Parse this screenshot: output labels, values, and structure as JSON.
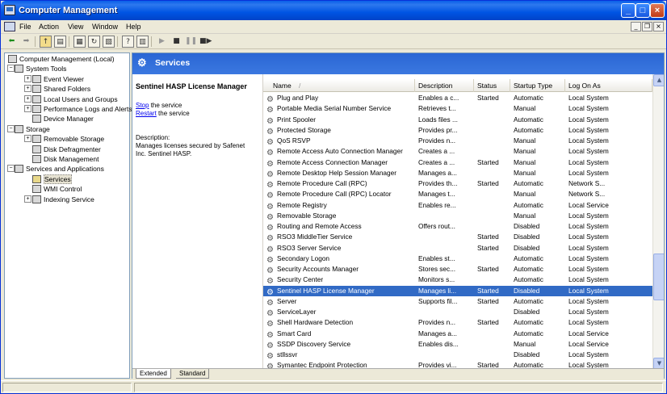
{
  "window": {
    "title": "Computer Management"
  },
  "menu": [
    "File",
    "Action",
    "View",
    "Window",
    "Help"
  ],
  "tree": [
    {
      "label": "Computer Management (Local)",
      "level": 0,
      "exp": "",
      "icon": "computer-icon"
    },
    {
      "label": "System Tools",
      "level": 1,
      "exp": "−",
      "icon": "tools-icon"
    },
    {
      "label": "Event Viewer",
      "level": 2,
      "exp": "+",
      "icon": "event-viewer-icon"
    },
    {
      "label": "Shared Folders",
      "level": 2,
      "exp": "+",
      "icon": "folder-icon"
    },
    {
      "label": "Local Users and Groups",
      "level": 2,
      "exp": "+",
      "icon": "users-icon"
    },
    {
      "label": "Performance Logs and Alerts",
      "level": 2,
      "exp": "+",
      "icon": "performance-icon"
    },
    {
      "label": "Device Manager",
      "level": 2,
      "exp": "",
      "icon": "device-manager-icon"
    },
    {
      "label": "Storage",
      "level": 1,
      "exp": "−",
      "icon": "storage-icon"
    },
    {
      "label": "Removable Storage",
      "level": 2,
      "exp": "+",
      "icon": "removable-storage-icon"
    },
    {
      "label": "Disk Defragmenter",
      "level": 2,
      "exp": "",
      "icon": "defrag-icon"
    },
    {
      "label": "Disk Management",
      "level": 2,
      "exp": "",
      "icon": "disk-icon"
    },
    {
      "label": "Services and Applications",
      "level": 1,
      "exp": "−",
      "icon": "services-apps-icon"
    },
    {
      "label": "Services",
      "level": 2,
      "exp": "",
      "icon": "gears-icon",
      "selected": true
    },
    {
      "label": "WMI Control",
      "level": 2,
      "exp": "",
      "icon": "wmi-icon"
    },
    {
      "label": "Indexing Service",
      "level": 2,
      "exp": "+",
      "icon": "indexing-icon"
    }
  ],
  "panel": {
    "title": "Services"
  },
  "details": {
    "service_name": "Sentinel HASP License Manager",
    "stop_link": "Stop",
    "stop_rest": " the service",
    "restart_link": "Restart",
    "restart_rest": " the service",
    "desc_label": "Description:",
    "desc_text": "Manages licenses secured by Safenet Inc. Sentinel HASP."
  },
  "columns": [
    "Name",
    "Description",
    "Status",
    "Startup Type",
    "Log On As"
  ],
  "sort_indicator": "/",
  "services": [
    {
      "name": "Plug and Play",
      "desc": "Enables a c...",
      "status": "Started",
      "startup": "Automatic",
      "logon": "Local System"
    },
    {
      "name": "Portable Media Serial Number Service",
      "desc": "Retrieves t...",
      "status": "",
      "startup": "Manual",
      "logon": "Local System"
    },
    {
      "name": "Print Spooler",
      "desc": "Loads files ...",
      "status": "",
      "startup": "Automatic",
      "logon": "Local System"
    },
    {
      "name": "Protected Storage",
      "desc": "Provides pr...",
      "status": "",
      "startup": "Automatic",
      "logon": "Local System"
    },
    {
      "name": "QoS RSVP",
      "desc": "Provides n...",
      "status": "",
      "startup": "Manual",
      "logon": "Local System"
    },
    {
      "name": "Remote Access Auto Connection Manager",
      "desc": "Creates a ...",
      "status": "",
      "startup": "Manual",
      "logon": "Local System"
    },
    {
      "name": "Remote Access Connection Manager",
      "desc": "Creates a ...",
      "status": "Started",
      "startup": "Manual",
      "logon": "Local System"
    },
    {
      "name": "Remote Desktop Help Session Manager",
      "desc": "Manages a...",
      "status": "",
      "startup": "Manual",
      "logon": "Local System"
    },
    {
      "name": "Remote Procedure Call (RPC)",
      "desc": "Provides th...",
      "status": "Started",
      "startup": "Automatic",
      "logon": "Network S..."
    },
    {
      "name": "Remote Procedure Call (RPC) Locator",
      "desc": "Manages t...",
      "status": "",
      "startup": "Manual",
      "logon": "Network S..."
    },
    {
      "name": "Remote Registry",
      "desc": "Enables re...",
      "status": "",
      "startup": "Automatic",
      "logon": "Local Service"
    },
    {
      "name": "Removable Storage",
      "desc": "",
      "status": "",
      "startup": "Manual",
      "logon": "Local System"
    },
    {
      "name": "Routing and Remote Access",
      "desc": "Offers rout...",
      "status": "",
      "startup": "Disabled",
      "logon": "Local System"
    },
    {
      "name": "RSO3 MiddleTier Service",
      "desc": "",
      "status": "Started",
      "startup": "Disabled",
      "logon": "Local System"
    },
    {
      "name": "RSO3 Server Service",
      "desc": "",
      "status": "Started",
      "startup": "Disabled",
      "logon": "Local System"
    },
    {
      "name": "Secondary Logon",
      "desc": "Enables st...",
      "status": "",
      "startup": "Automatic",
      "logon": "Local System"
    },
    {
      "name": "Security Accounts Manager",
      "desc": "Stores sec...",
      "status": "Started",
      "startup": "Automatic",
      "logon": "Local System"
    },
    {
      "name": "Security Center",
      "desc": "Monitors s...",
      "status": "",
      "startup": "Automatic",
      "logon": "Local System"
    },
    {
      "name": "Sentinel HASP License Manager",
      "desc": "Manages li...",
      "status": "Started",
      "startup": "Disabled",
      "logon": "Local System",
      "selected": true
    },
    {
      "name": "Server",
      "desc": "Supports fil...",
      "status": "Started",
      "startup": "Automatic",
      "logon": "Local System"
    },
    {
      "name": "ServiceLayer",
      "desc": "",
      "status": "",
      "startup": "Disabled",
      "logon": "Local System"
    },
    {
      "name": "Shell Hardware Detection",
      "desc": "Provides n...",
      "status": "Started",
      "startup": "Automatic",
      "logon": "Local System"
    },
    {
      "name": "Smart Card",
      "desc": "Manages a...",
      "status": "",
      "startup": "Automatic",
      "logon": "Local Service"
    },
    {
      "name": "SSDP Discovery Service",
      "desc": "Enables dis...",
      "status": "",
      "startup": "Manual",
      "logon": "Local Service"
    },
    {
      "name": "stllssvr",
      "desc": "",
      "status": "",
      "startup": "Disabled",
      "logon": "Local System"
    },
    {
      "name": "Symantec Endpoint Protection",
      "desc": "Provides vi...",
      "status": "Started",
      "startup": "Automatic",
      "logon": "Local System"
    }
  ],
  "tabs": [
    "Extended",
    "Standard"
  ],
  "colors": {
    "selection": "#316ac5",
    "header_blue": "#2a66d4",
    "link": "#0000ee"
  }
}
